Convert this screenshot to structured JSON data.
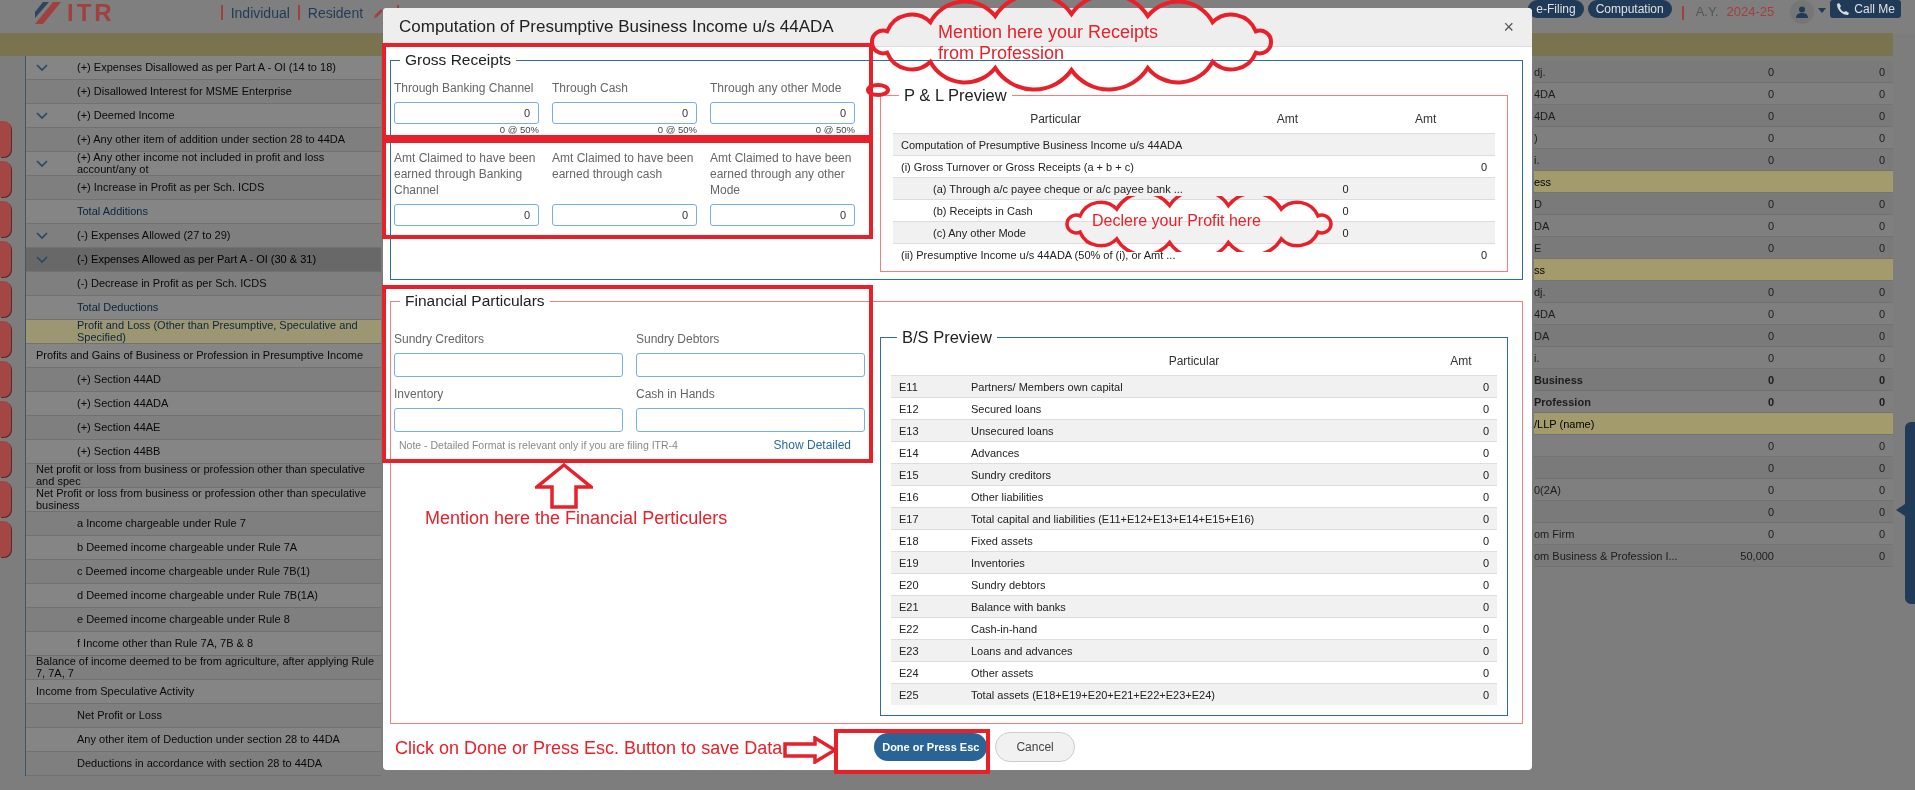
{
  "header": {
    "logo": "ITR",
    "profile": [
      "Individual",
      "Resident"
    ],
    "nav": [
      "e-Filing",
      "Computation"
    ],
    "ay_label": "A.Y.",
    "ay_value": "2024-25",
    "call_button": "Call Me"
  },
  "left_table": {
    "rows": [
      {
        "label": "(+) Expenses Disallowed as per Part A - OI (14 to 18)",
        "kind": "group",
        "selected": false
      },
      {
        "label": "(+) Disallowed Interest for MSME Enterprise",
        "kind": "item",
        "selected": false
      },
      {
        "label": "(+) Deemed Income",
        "kind": "group",
        "selected": false
      },
      {
        "label": "(+) Any other item of addition under section 28 to 44DA",
        "kind": "item",
        "selected": false
      },
      {
        "label": "(+) Any other income not included in profit and loss account/any ot",
        "kind": "group",
        "selected": false
      },
      {
        "label": "(+) Increase in Profit as per Sch. ICDS",
        "kind": "item",
        "selected": false
      },
      {
        "label": "Total Additions",
        "kind": "total",
        "selected": false
      },
      {
        "label": "(-) Expenses Allowed (27 to 29)",
        "kind": "group",
        "selected": false
      },
      {
        "label": "(-) Expenses Allowed as per Part A - OI (30 & 31)",
        "kind": "group",
        "selected": true
      },
      {
        "label": "(-) Decrease in Profit as per Sch. ICDS",
        "kind": "item",
        "selected": false
      },
      {
        "label": "Total Deductions",
        "kind": "total",
        "selected": false
      },
      {
        "label": "Profit and Loss (Other than Presumptive, Speculative and Specified)",
        "kind": "subtotal",
        "selected": false
      },
      {
        "label": "Profits and Gains of Business or Profession in Presumptive Income",
        "kind": "heading",
        "selected": false
      },
      {
        "label": "(+) Section 44AD",
        "kind": "item",
        "selected": false
      },
      {
        "label": "(+) Section 44ADA",
        "kind": "item",
        "selected": false
      },
      {
        "label": "(+) Section 44AE",
        "kind": "item",
        "selected": false
      },
      {
        "label": "(+) Section 44BB",
        "kind": "item",
        "selected": false
      },
      {
        "label": "Net profit or loss from business or profession other than speculative and spec",
        "kind": "heading",
        "selected": false
      },
      {
        "label": "Net Profit or loss from business or profession other than speculative business",
        "kind": "heading",
        "selected": false
      },
      {
        "label": "a Income chargeable under Rule 7",
        "kind": "item",
        "selected": false
      },
      {
        "label": "b Deemed income chargeable under Rule 7A",
        "kind": "item",
        "selected": false
      },
      {
        "label": "c Deemed income chargeable under Rule 7B(1)",
        "kind": "item",
        "selected": false
      },
      {
        "label": "d Deemed income chargeable under Rule 7B(1A)",
        "kind": "item",
        "selected": false
      },
      {
        "label": "e Deemed income chargeable under Rule 8",
        "kind": "item",
        "selected": false
      },
      {
        "label": "f Income other than Rule 7A, 7B & 8",
        "kind": "item",
        "selected": false
      },
      {
        "label": "Balance of income deemed to be from agriculture, after applying Rule 7, 7A, 7",
        "kind": "heading",
        "selected": false
      },
      {
        "label": "Income from Speculative Activity",
        "kind": "heading",
        "selected": false
      },
      {
        "label": "Net Profit or Loss",
        "kind": "item",
        "selected": false
      },
      {
        "label": "Any other item of Deduction under section 28 to 44DA",
        "kind": "item",
        "selected": false
      },
      {
        "label": "Deductions in accordance with section 28 to 44DA",
        "kind": "item",
        "selected": false
      }
    ]
  },
  "right_table": {
    "rows": [
      {
        "label": "dj.",
        "amt_1": "0",
        "amt_2": "0",
        "kind": "row"
      },
      {
        "label": "4DA",
        "amt_1": "0",
        "amt_2": "0",
        "kind": "row"
      },
      {
        "label": "4DA",
        "amt_1": "0",
        "amt_2": "0",
        "kind": "row"
      },
      {
        "label": ")",
        "amt_1": "0",
        "amt_2": "0",
        "kind": "row"
      },
      {
        "label": "i.",
        "amt_1": "0",
        "amt_2": "0",
        "kind": "row"
      },
      {
        "label": "ess",
        "kind": "section"
      },
      {
        "label": "D",
        "amt_1": "0",
        "amt_2": "0",
        "kind": "row"
      },
      {
        "label": "DA",
        "amt_1": "0",
        "amt_2": "0",
        "kind": "row"
      },
      {
        "label": "E",
        "amt_1": "0",
        "amt_2": "0",
        "kind": "row"
      },
      {
        "label": "ss",
        "kind": "section"
      },
      {
        "label": "dj.",
        "amt_1": "0",
        "amt_2": "0",
        "kind": "row"
      },
      {
        "label": "4DA",
        "amt_1": "0",
        "amt_2": "0",
        "kind": "row"
      },
      {
        "label": "DA",
        "amt_1": "0",
        "amt_2": "0",
        "kind": "row"
      },
      {
        "label": "i.",
        "amt_1": "0",
        "amt_2": "0",
        "kind": "row"
      },
      {
        "label": "Business",
        "amt_1": "0",
        "amt_2": "0",
        "kind": "total"
      },
      {
        "label": "Profession",
        "amt_1": "0",
        "amt_2": "0",
        "kind": "total"
      },
      {
        "label": "/LLP (name)",
        "kind": "section"
      },
      {
        "amt_1": "0",
        "amt_2": "0",
        "kind": "row"
      },
      {
        "amt_1": "0",
        "amt_2": "0",
        "kind": "row"
      },
      {
        "label": "0(2A)",
        "amt_1": "0",
        "amt_2": "0",
        "kind": "row"
      },
      {
        "amt_1": "0",
        "amt_2": "0",
        "kind": "row"
      },
      {
        "label": "om Firm",
        "amt_1": "0",
        "amt_2": "0",
        "kind": "row"
      },
      {
        "label": "om Business & Profession I...",
        "amt_1": "50,000",
        "amt_2": "0",
        "kind": "row"
      }
    ]
  },
  "modal": {
    "title": "Computation of Presumptive Business Income u/s 44ADA",
    "close": "×",
    "gross_receipts": {
      "legend": "Gross Receipts",
      "fields": [
        {
          "label": "Through Banking Channel",
          "value": "0",
          "note": "0 @ 50%"
        },
        {
          "label": "Through Cash",
          "value": "0",
          "note": "0 @ 50%"
        },
        {
          "label": "Through any other Mode",
          "value": "0",
          "note": "0 @ 50%"
        }
      ],
      "claimed_fields": [
        {
          "label": "Amt Claimed to have been earned through Banking Channel",
          "value": "0"
        },
        {
          "label": "Amt Claimed to have been earned through cash",
          "value": "0"
        },
        {
          "label": "Amt Claimed to have been earned through any other Mode",
          "value": "0"
        }
      ]
    },
    "pl_preview": {
      "legend": "P & L Preview",
      "columns": [
        "Particular",
        "Amt",
        "Amt"
      ],
      "rows": [
        {
          "particular": "Computation of Presumptive Business Income u/s 44ADA"
        },
        {
          "particular": "(i) Gross Turnover or Gross Receipts (a + b + c)",
          "amt_2": "0",
          "children": [
            {
              "particular": "(a) Through a/c payee cheque or a/c payee bank ...",
              "amt_1": "0"
            },
            {
              "particular": "(b) Receipts in Cash",
              "amt_1": "0"
            },
            {
              "particular": "(c) Any other Mode",
              "amt_1": "0"
            }
          ]
        },
        {
          "particular": "(ii) Presumptive Income u/s 44ADA (50% of (i), or Amt ...",
          "amt_2": "0"
        }
      ]
    },
    "financial_particulars": {
      "legend": "Financial Particulars",
      "fields": [
        {
          "label": "Sundry Creditors"
        },
        {
          "label": "Sundry Debtors"
        },
        {
          "label": "Inventory"
        },
        {
          "label": "Cash in Hands"
        }
      ],
      "note": "Note - Detailed Format is relevant only if you are filing ITR-4",
      "link": "Show Detailed"
    },
    "bs_preview": {
      "legend": "B/S Preview",
      "columns": [
        "Particular",
        "Amt"
      ],
      "rows": [
        {
          "code": "E11",
          "particular": "Partners/ Members own capital",
          "amt": "0"
        },
        {
          "code": "E12",
          "particular": "Secured loans",
          "amt": "0"
        },
        {
          "code": "E13",
          "particular": "Unsecured loans",
          "amt": "0"
        },
        {
          "code": "E14",
          "particular": "Advances",
          "amt": "0"
        },
        {
          "code": "E15",
          "particular": "Sundry creditors",
          "amt": "0"
        },
        {
          "code": "E16",
          "particular": "Other liabilities",
          "amt": "0"
        },
        {
          "code": "E17",
          "particular": "Total capital and liabilities (E11+E12+E13+E14+E15+E16)",
          "amt": "0"
        },
        {
          "code": "E18",
          "particular": "Fixed assets",
          "amt": "0"
        },
        {
          "code": "E19",
          "particular": "Inventories",
          "amt": "0"
        },
        {
          "code": "E20",
          "particular": "Sundry debtors",
          "amt": "0"
        },
        {
          "code": "E21",
          "particular": "Balance with banks",
          "amt": "0"
        },
        {
          "code": "E22",
          "particular": "Cash-in-hand",
          "amt": "0"
        },
        {
          "code": "E23",
          "particular": "Loans and advances",
          "amt": "0"
        },
        {
          "code": "E24",
          "particular": "Other assets",
          "amt": "0"
        },
        {
          "code": "E25",
          "particular": "Total assets (E18+E19+E20+E21+E22+E23+E24)",
          "amt": "0"
        }
      ]
    },
    "buttons": {
      "done": "Done or Press Esc",
      "cancel": "Cancel"
    }
  },
  "annotations": {
    "receipts_callout": "Mention here your Receipts from Profession",
    "profit_callout": "Declere your Profit here",
    "financial_callout": "Mention here the Financial Perticulers",
    "save_callout": "Click on Done or Press Esc. Button to save Data"
  }
}
